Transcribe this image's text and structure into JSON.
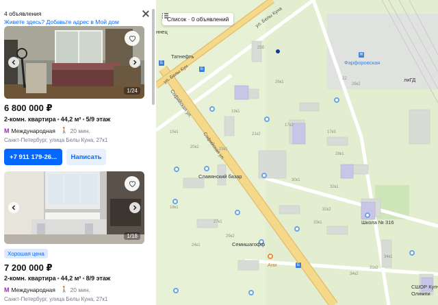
{
  "panel": {
    "count_label": "4 объявления",
    "address_prompt": "Живете здесь? Добавьте адрес в Мой дом",
    "listings": [
      {
        "photo_counter": "1/24",
        "price": "6 800 000 ₽",
        "rooms": "2-комн. квартира",
        "area": "44,2 м²",
        "floor": "5/9 этаж",
        "metro": "Международная",
        "walk": "20 мин.",
        "address": "Санкт-Петербург, улица Белы Куна, 27к1",
        "phone_label": "+7 911 179-26...",
        "message_label": "Написать"
      },
      {
        "photo_counter": "1/18",
        "badge": "Хорошая цена",
        "price": "7 200 000 ₽",
        "rooms": "2-комн. квартира",
        "area": "44,2 м²",
        "floor": "8/9 этаж",
        "metro": "Международная",
        "walk": "20 мин.",
        "address": "Санкт-Петербург, улица Белы Куна, 27к1"
      }
    ]
  },
  "map": {
    "list_button": "Список · 0 объявлений",
    "streets": [
      "ул. Белы Куна",
      "Софийская ул.",
      "ул. Белы Кун"
    ],
    "places": [
      "Татнефть",
      "Фарфоровская",
      "Славянский базар",
      "Школа № 316",
      "Семишагофф",
      "Ани",
      "СШОР Купчи",
      "Олимпи",
      "ннец",
      "лиГД"
    ],
    "house_numbers": [
      "25б",
      "22",
      "26к1",
      "26к2",
      "19к1",
      "17к2",
      "17к3",
      "28к1",
      "30к1",
      "32к1",
      "32к2",
      "34к1",
      "34к2",
      "21к2",
      "23к1",
      "20к2",
      "27к1",
      "29к2",
      "33к1",
      "24к1",
      "18к1",
      "15к1",
      "31к2"
    ],
    "colors": {
      "accent": "#0468ff",
      "map_bg": "#e7f1d6",
      "road_main": "#f5d98b"
    }
  }
}
